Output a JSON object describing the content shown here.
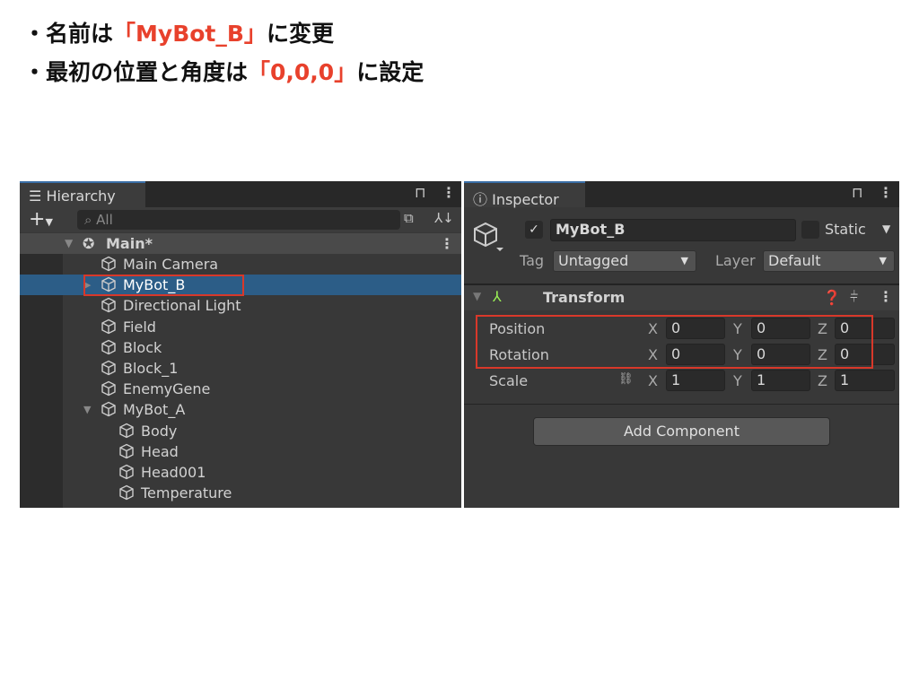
{
  "slide": {
    "line1": {
      "pre": "・名前は",
      "highlight": "「MyBot_B」",
      "post": "に変更"
    },
    "line2": {
      "pre": "・最初の位置と角度は",
      "highlight": "「0,0,0」",
      "post": "に設定"
    },
    "highlight_color": "#e8412c"
  },
  "hierarchy": {
    "tab": "Hierarchy",
    "search_placeholder": "All",
    "scene": "Main*",
    "items": [
      {
        "label": "Main Camera",
        "depth": 1
      },
      {
        "label": "MyBot_B",
        "depth": 1,
        "selected": true,
        "collapsed": true
      },
      {
        "label": "Directional Light",
        "depth": 1
      },
      {
        "label": "Field",
        "depth": 1
      },
      {
        "label": "Block",
        "depth": 1
      },
      {
        "label": "Block_1",
        "depth": 1
      },
      {
        "label": "EnemyGene",
        "depth": 1
      },
      {
        "label": "MyBot_A",
        "depth": 1,
        "expanded": true
      },
      {
        "label": "Body",
        "depth": 2
      },
      {
        "label": "Head",
        "depth": 2
      },
      {
        "label": "Head001",
        "depth": 2
      },
      {
        "label": "Temperature",
        "depth": 2
      }
    ]
  },
  "inspector": {
    "tab": "Inspector",
    "name": "MyBot_B",
    "active": true,
    "static_label": "Static",
    "tag_label": "Tag",
    "tag": "Untagged",
    "layer_label": "Layer",
    "layer": "Default",
    "transform": {
      "title": "Transform",
      "rows": [
        {
          "label": "Position",
          "x": "0",
          "y": "0",
          "z": "0"
        },
        {
          "label": "Rotation",
          "x": "0",
          "y": "0",
          "z": "0"
        },
        {
          "label": "Scale",
          "x": "1",
          "y": "1",
          "z": "1"
        }
      ],
      "axis": {
        "x": "X",
        "y": "Y",
        "z": "Z"
      }
    },
    "add_component": "Add Component"
  }
}
